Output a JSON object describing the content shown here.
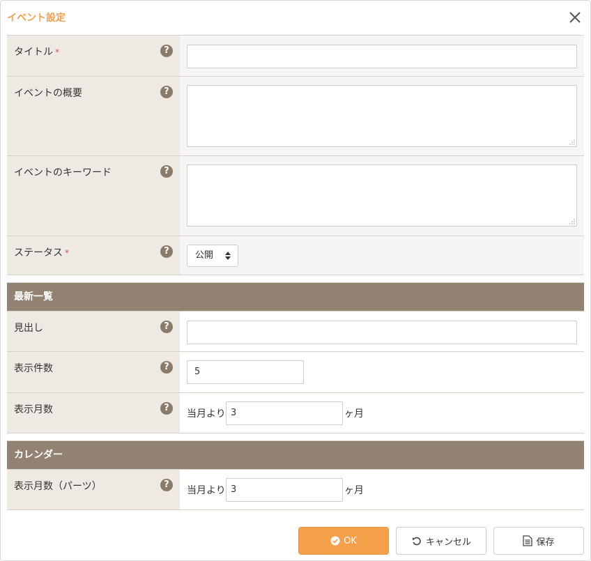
{
  "dialog": {
    "title": "イベント設定"
  },
  "fields": {
    "title_label": "タイトル",
    "title_required": "*",
    "title_value": "",
    "summary_label": "イベントの概要",
    "summary_value": "",
    "keywords_label": "イベントのキーワード",
    "keywords_value": "",
    "status_label": "ステータス",
    "status_required": "*",
    "status_value": "公開"
  },
  "latest_section": {
    "heading": "最新一覧",
    "headline_label": "見出し",
    "headline_value": "",
    "count_label": "表示件数",
    "count_value": "5",
    "months_label": "表示月数",
    "months_prefix": "当月より",
    "months_value": "3",
    "months_suffix": "ヶ月"
  },
  "calendar_section": {
    "heading": "カレンダー",
    "months_label": "表示月数（パーツ）",
    "months_prefix": "当月より",
    "months_value": "3",
    "months_suffix": "ヶ月"
  },
  "footer": {
    "ok_label": "OK",
    "cancel_label": "キャンセル",
    "save_label": "保存"
  },
  "icons": {
    "help": "?"
  },
  "colors": {
    "accent": "#f0a050",
    "ok_button": "#f5a04a",
    "section_header": "#928271",
    "label_bg": "#eee9e2",
    "help_icon": "#8c7b6b",
    "required": "#d9534f"
  }
}
